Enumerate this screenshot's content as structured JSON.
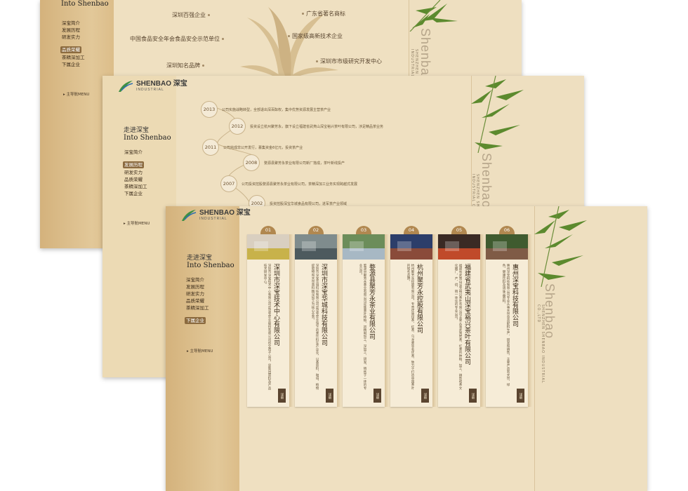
{
  "brand": {
    "name": "SHENBAO 深宝",
    "sub": "INDUSTRIAL"
  },
  "into": {
    "cn": "走进深宝",
    "en": "Into Shenbao"
  },
  "main_nav_label": "▸ 主导航MENU",
  "side_word": "Shenbao",
  "side_sub": "SHENZHEN SHENBAO INDUSTRIAL CO.,LTD",
  "board1": {
    "menu": [
      "深宝简介",
      "发展历程",
      "研发实力",
      "品质荣耀",
      "茶精深加工",
      "下属企业"
    ],
    "active_index": 3,
    "honors": [
      "深圳百强企业",
      "广东省著名商标",
      "中国食品安全年会食品安全示范单位",
      "国家级高新技术企业",
      "深圳知名品牌",
      "深圳市市级研究开发中心"
    ]
  },
  "board2": {
    "menu": [
      "深宝简介",
      "发展历程",
      "研发实力",
      "品质荣耀",
      "茶精深加工",
      "下属企业"
    ],
    "active_index": 1,
    "timeline": [
      {
        "year": "2013",
        "text": "公司实施战略转型，全部退出深百酝权，集中优势资源发展主营茶产业"
      },
      {
        "year": "2012",
        "text": "投资设立杭州聚芳永，旗下设立福建省武夷山深宝裕兴茶叶有限公司，涉足精品茶业务"
      },
      {
        "year": "2011",
        "text": "公司完成非公开发行，募集资金6亿元，投资茶产业"
      },
      {
        "year": "2008",
        "text": "婺源县聚芳永茶业有限公司新厂落成，茶叶新线投产"
      },
      {
        "year": "2007",
        "text": "公司投资控股婺源县聚芳永茶业有限公司，茶精深加工业务实现跨越式发展"
      },
      {
        "year": "2002",
        "text": "投资控股深宝华城食品有限公司，进军茶产业领域"
      }
    ]
  },
  "board3": {
    "menu": [
      "深宝简介",
      "发展历程",
      "研发实力",
      "品质荣耀",
      "茶精深加工",
      "下属企业"
    ],
    "active_index": 5,
    "cards": [
      {
        "num": "01",
        "title": "深圳市深宝技术中心有限公司",
        "desc": "深圳市深宝技术中心有限公司是深宝实业股份有限公司的全资子公司，是集团原料及产品技术研发中心。",
        "more": "详细"
      },
      {
        "num": "02",
        "title": "深圳市深宝华城科技有限公司",
        "desc": "深圳市深宝华城科技有限公司是深宝实业旗下的茶饮料生产企业，以茶原料、咖啡、植物提取物和天然香料精深加工为核心业务。",
        "more": "详细"
      },
      {
        "num": "03",
        "title": "婺源县聚芳永茶业有限公司",
        "desc": "婺源县聚芳永茶业有限公司是集茶叶种植、初精制加工、深加工、研发、销售于一体的专业公司。",
        "more": "详细"
      },
      {
        "num": "04",
        "title": "杭州聚芳永控股有限公司",
        "desc": "杭州聚芳永控股有限公司，专营优质绿茶、红茶、乌龙茶等名优茶，致力于打造中国茶叶的知名品牌。",
        "more": "详细"
      },
      {
        "num": "05",
        "title": "福建省武夷山深宝裕兴茶叶有限公司",
        "desc": "福建省武夷山深宝裕兴茶叶有限公司主要从事武夷岩茶、红茶的种植、加工、销售和茶文化推广，产、供、销一体化的专业公司。",
        "more": "详细"
      },
      {
        "num": "06",
        "title": "惠州深宝科技有限公司",
        "desc": "惠州深宝科技有限公司专业从事天然食品配料生产、研发和销售，主要产品有天然、绿色、健康饮料及调味品原料。",
        "more": "详细"
      }
    ]
  }
}
